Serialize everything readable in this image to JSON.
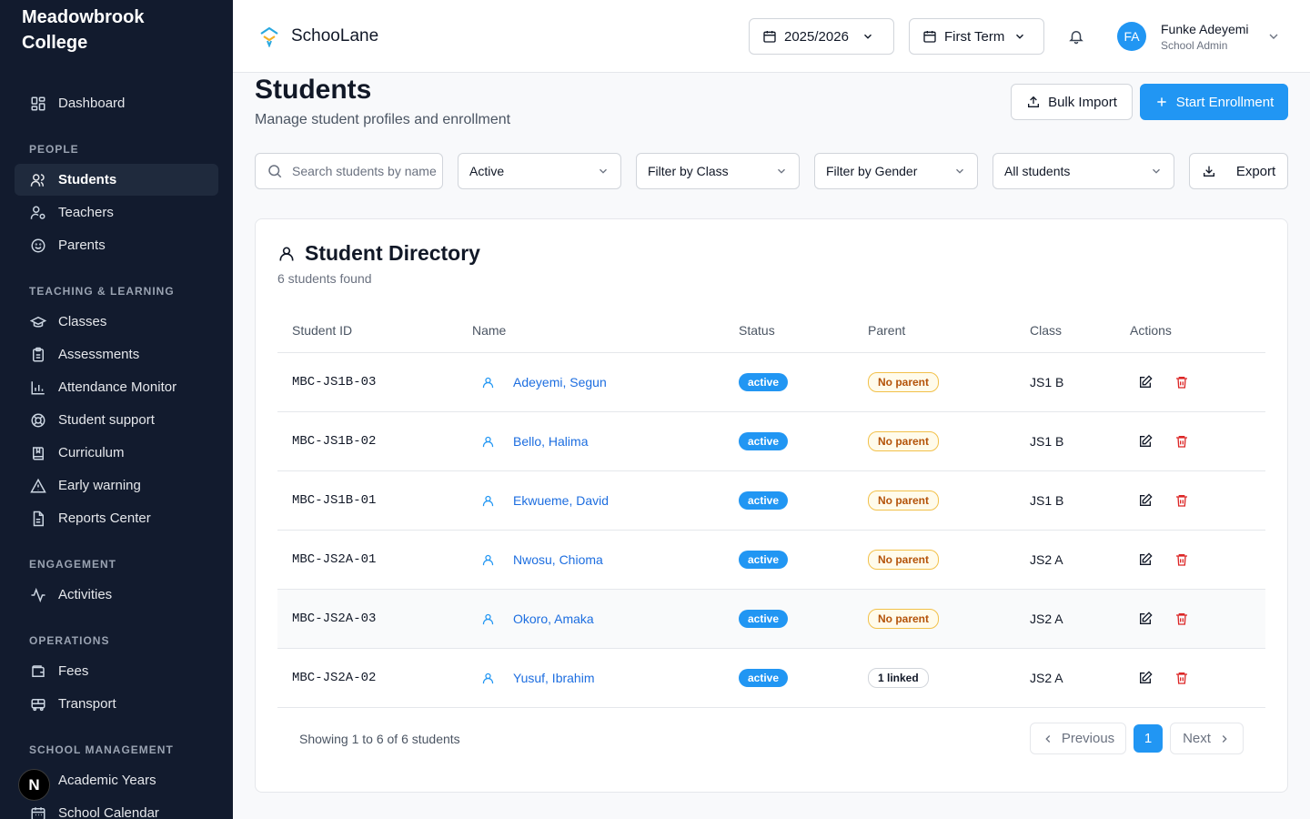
{
  "sidebar": {
    "brand": "Meadowbrook College",
    "dashboard": "Dashboard",
    "sections": {
      "people": "PEOPLE",
      "teaching": "TEACHING & LEARNING",
      "engagement": "ENGAGEMENT",
      "operations": "OPERATIONS",
      "management": "SCHOOL MANAGEMENT"
    },
    "items": {
      "students": "Students",
      "teachers": "Teachers",
      "parents": "Parents",
      "classes": "Classes",
      "assessments": "Assessments",
      "attendance": "Attendance Monitor",
      "support": "Student support",
      "curriculum": "Curriculum",
      "early_warning": "Early warning",
      "reports": "Reports Center",
      "activities": "Activities",
      "fees": "Fees",
      "transport": "Transport",
      "academic_years": "Academic Years",
      "calendar": "School Calendar"
    },
    "badge": "N"
  },
  "header": {
    "app_name": "SchooLane",
    "year": "2025/2026",
    "term": "First Term",
    "user": {
      "initials": "FA",
      "name": "Funke Adeyemi",
      "role": "School Admin"
    }
  },
  "page": {
    "title": "Students",
    "subtitle": "Manage student profiles and enrollment",
    "bulk_import": "Bulk Import",
    "start_enrollment": "Start Enrollment"
  },
  "filters": {
    "search_placeholder": "Search students by name",
    "status": "Active",
    "class": "Filter by Class",
    "gender": "Filter by Gender",
    "scope": "All students",
    "export": "Export"
  },
  "directory": {
    "title": "Student Directory",
    "count": "6 students found",
    "columns": {
      "id": "Student ID",
      "name": "Name",
      "status": "Status",
      "parent": "Parent",
      "class": "Class",
      "actions": "Actions"
    },
    "rows": [
      {
        "id": "MBC-JS1B-03",
        "name": "Adeyemi, Segun",
        "status": "active",
        "parent": "No parent",
        "class": "JS1 B"
      },
      {
        "id": "MBC-JS1B-02",
        "name": "Bello, Halima",
        "status": "active",
        "parent": "No parent",
        "class": "JS1 B"
      },
      {
        "id": "MBC-JS1B-01",
        "name": "Ekwueme, David",
        "status": "active",
        "parent": "No parent",
        "class": "JS1 B"
      },
      {
        "id": "MBC-JS2A-01",
        "name": "Nwosu, Chioma",
        "status": "active",
        "parent": "No parent",
        "class": "JS2 A"
      },
      {
        "id": "MBC-JS2A-03",
        "name": "Okoro, Amaka",
        "status": "active",
        "parent": "No parent",
        "class": "JS2 A"
      },
      {
        "id": "MBC-JS2A-02",
        "name": "Yusuf, Ibrahim",
        "status": "active",
        "parent": "1 linked",
        "class": "JS2 A"
      }
    ],
    "showing": "Showing 1 to 6 of 6 students",
    "pagination": {
      "previous": "Previous",
      "current": "1",
      "next": "Next"
    }
  },
  "colors": {
    "sidebar_bg": "#121b2e",
    "accent": "#2196f3",
    "danger": "#dc2626",
    "warning": "#b45309"
  }
}
